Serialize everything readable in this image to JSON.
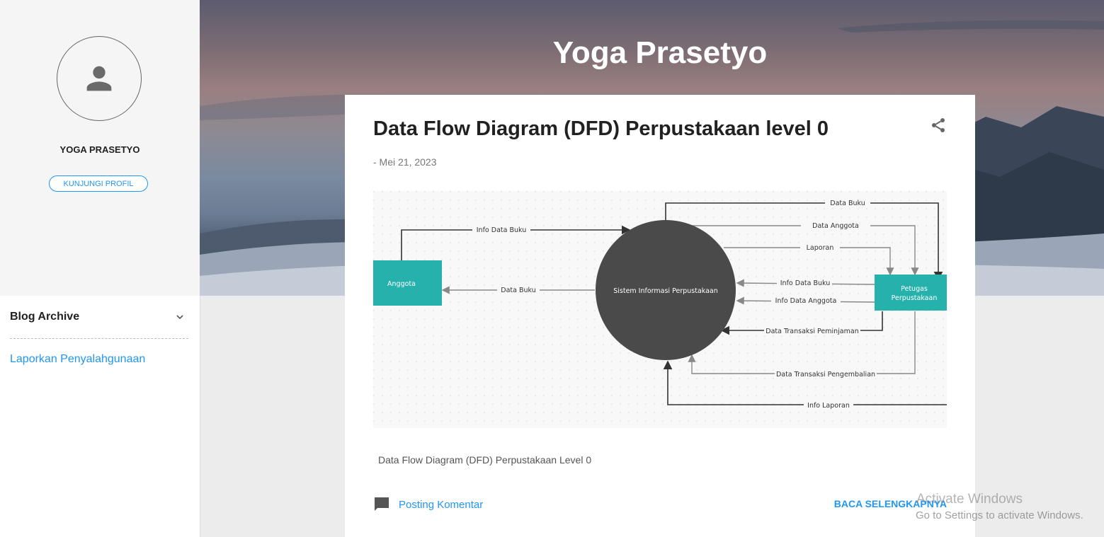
{
  "sidebar": {
    "profile_name": "YOGA PRASETYO",
    "visit_profile": "KUNJUNGI PROFIL",
    "archive_title": "Blog Archive",
    "report_link": "Laporkan Penyalahgunaan",
    "icons": {
      "avatar": "person-icon",
      "archive_toggle": "chevron-down-icon"
    }
  },
  "header": {
    "blog_title": "Yoga Prasetyo"
  },
  "post": {
    "title": "Data Flow Diagram (DFD) Perpustakaan level 0",
    "date": "- Mei 21, 2023",
    "caption": "Data Flow Diagram (DFD) Perpustakaan Level 0",
    "comment_label": "Posting Komentar",
    "read_more": "BACA SELENGKAPNYA",
    "icons": {
      "share": "share-icon",
      "comment": "comment-icon"
    }
  },
  "diagram": {
    "entity_left": "Anggota",
    "entity_right_line1": "Petugas",
    "entity_right_line2": "Perpustakaan",
    "process": "Sistem Informasi Perpustakaan",
    "flows": {
      "data_buku_top": "Data Buku",
      "data_anggota": "Data Anggota",
      "laporan": "Laporan",
      "info_data_buku_left": "Info Data Buku",
      "data_buku_left": "Data Buku",
      "info_data_buku_right": "Info Data Buku",
      "info_data_anggota": "Info Data Anggota",
      "data_transaksi_peminjaman": "Data Transaksi Peminjaman",
      "data_transaksi_pengembalian": "Data Transaksi Pengembalian",
      "info_laporan": "Info Laporan"
    },
    "colors": {
      "entity": "#26b1ad",
      "process": "#4a4a4a"
    }
  },
  "watermark": {
    "line1": "Activate Windows",
    "line2": "Go to Settings to activate Windows."
  }
}
